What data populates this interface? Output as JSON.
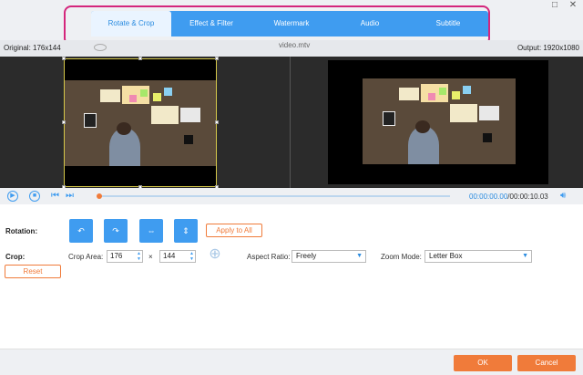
{
  "tabs": [
    {
      "label": "Rotate & Crop",
      "active": true
    },
    {
      "label": "Effect & Filter",
      "active": false
    },
    {
      "label": "Watermark",
      "active": false
    },
    {
      "label": "Audio",
      "active": false
    },
    {
      "label": "Subtitle",
      "active": false
    }
  ],
  "window": {
    "restore_icon": "□",
    "close_icon": "✕"
  },
  "info": {
    "original": "Original: 176x144",
    "filename": "video.mtv",
    "output": "Output: 1920x1080"
  },
  "playback": {
    "current_time": "00:00:00.00",
    "total_time": "/00:00:10.03",
    "progress": 0.0
  },
  "rotation": {
    "label": "Rotation:",
    "buttons": [
      "rotate-left-icon",
      "rotate-right-icon",
      "flip-horizontal-icon",
      "flip-vertical-icon"
    ],
    "apply_all": "Apply to All"
  },
  "crop": {
    "label": "Crop:",
    "area_label": "Crop Area:",
    "width": "176",
    "times": "×",
    "height": "144",
    "reset": "Reset",
    "aspect_label": "Aspect Ratio:",
    "aspect_value": "Freely",
    "zoom_label": "Zoom Mode:",
    "zoom_value": "Letter Box"
  },
  "footer": {
    "ok": "OK",
    "cancel": "Cancel"
  },
  "colors": {
    "accent": "#3f9cf0",
    "orange": "#f07b3a",
    "highlight": "#d4267c"
  }
}
